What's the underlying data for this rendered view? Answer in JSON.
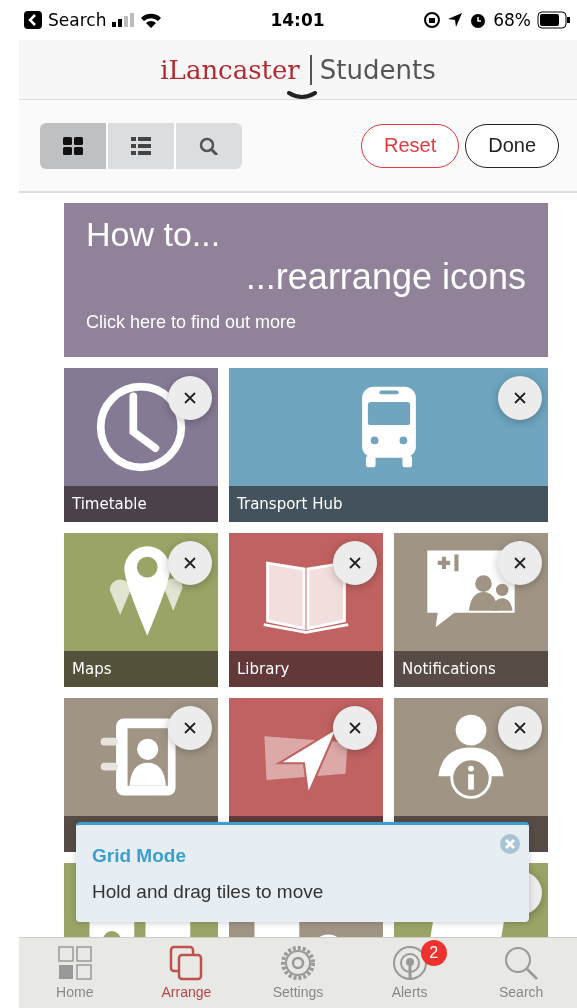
{
  "status_bar": {
    "back_label": "Search",
    "time": "14:01",
    "battery": "68%"
  },
  "header": {
    "brand": "iLancaster",
    "section": "Students"
  },
  "view_modes": [
    {
      "kind": "grid",
      "selected": true
    },
    {
      "kind": "list",
      "selected": false
    },
    {
      "kind": "search",
      "selected": false
    }
  ],
  "actions": [
    {
      "kind": "reset",
      "label": "Reset"
    },
    {
      "kind": "done",
      "label": "Done"
    }
  ],
  "banner": {
    "title": "How to...",
    "subtitle": "...rearrange icons",
    "link": "Click here to find out more"
  },
  "tiles": [
    {
      "label": "Timetable",
      "kind": "clock",
      "color": "#857a93",
      "wide": false,
      "caption_bar": true,
      "close_button": true
    },
    {
      "label": "Transport Hub",
      "kind": "bus",
      "color": "#6fa5bf",
      "wide": true,
      "caption_bar": true,
      "close_button": true
    },
    {
      "label": "Maps",
      "kind": "pin",
      "color": "#9aa466",
      "wide": false,
      "caption_bar": true,
      "close_button": true
    },
    {
      "label": "Library",
      "kind": "book",
      "color": "#c06261",
      "wide": false,
      "caption_bar": true,
      "close_button": true
    },
    {
      "label": "Notifications",
      "kind": "bubble",
      "color": "#a09585",
      "wide": false,
      "caption_bar": true,
      "close_button": true
    },
    {
      "kind": "contact",
      "color": "#a09585",
      "wide": false,
      "caption_bar": true,
      "close_button": true
    },
    {
      "kind": "arrow",
      "color": "#c06261",
      "wide": false,
      "caption_bar": true,
      "close_button": true
    },
    {
      "kind": "person",
      "color": "#a09585",
      "wide": false,
      "caption_bar": true,
      "close_button": true
    },
    {
      "kind": "blocks",
      "color": "#9aa466",
      "wide": false,
      "caption_bar": false,
      "close_button": false
    },
    {
      "kind": "ring",
      "color": "#a09585",
      "wide": false,
      "caption_bar": false,
      "close_button": false
    },
    {
      "kind": "stripe",
      "color": "#9aa466",
      "wide": false,
      "caption_bar": false,
      "close_button": true
    }
  ],
  "popup": {
    "title": "Grid Mode",
    "message": "Hold and drag tiles to move"
  },
  "tab_bar": [
    {
      "kind": "home",
      "label": "Home",
      "selected": false
    },
    {
      "kind": "arrange",
      "label": "Arrange",
      "selected": true
    },
    {
      "kind": "settings",
      "label": "Settings",
      "selected": false
    },
    {
      "kind": "alerts",
      "label": "Alerts",
      "selected": false,
      "badge": "2"
    },
    {
      "kind": "search",
      "label": "Search",
      "selected": false
    }
  ]
}
